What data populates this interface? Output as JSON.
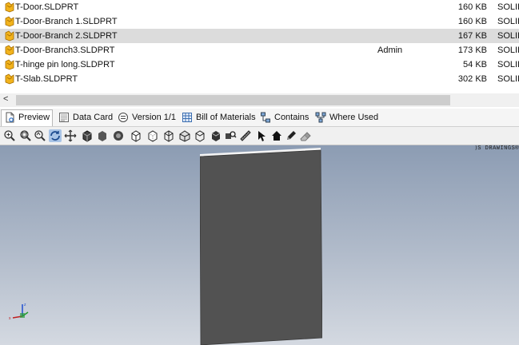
{
  "files": [
    {
      "name": "T-Door.SLDPRT",
      "user": "",
      "size": "160 KB",
      "type": "SOLID",
      "selected": false
    },
    {
      "name": "T-Door-Branch 1.SLDPRT",
      "user": "",
      "size": "160 KB",
      "type": "SOLID",
      "selected": false
    },
    {
      "name": "T-Door-Branch 2.SLDPRT",
      "user": "",
      "size": "167 KB",
      "type": "SOLID",
      "selected": true
    },
    {
      "name": "T-Door-Branch3.SLDPRT",
      "user": "Admin",
      "size": "173 KB",
      "type": "SOLID",
      "selected": false
    },
    {
      "name": "T-hinge pin long.SLDPRT",
      "user": "",
      "size": "54 KB",
      "type": "SOLID",
      "selected": false
    },
    {
      "name": "T-Slab.SLDPRT",
      "user": "",
      "size": "302 KB",
      "type": "SOLID",
      "selected": false
    }
  ],
  "scroll": {
    "left_arrow": "<"
  },
  "tabs": [
    {
      "label": "Preview",
      "icon": "preview-icon",
      "active": true
    },
    {
      "label": "Data Card",
      "icon": "data-card-icon",
      "active": false
    },
    {
      "label": "Version 1/1",
      "icon": "version-icon",
      "active": false
    },
    {
      "label": "Bill of Materials",
      "icon": "bill-of-materials-icon",
      "active": false
    },
    {
      "label": "Contains",
      "icon": "contains-icon",
      "active": false
    },
    {
      "label": "Where Used",
      "icon": "where-used-icon",
      "active": false
    }
  ],
  "toolbar": {
    "icons": [
      "zoom-to-fit-icon",
      "zoom-to-area-icon",
      "zoom-in-out-icon",
      "rotate-icon",
      "pan-icon",
      "shaded-with-edges-icon",
      "shaded-icon",
      "draft-quality-icon",
      "hidden-lines-removed-icon",
      "hidden-lines-visible-icon",
      "wireframe-icon",
      "perspective-icon",
      "isometric-icon",
      "view-cube-icon",
      "section-view-icon",
      "measure-icon",
      "select-icon",
      "home-view-icon",
      "markup-pen-icon",
      "erase-icon"
    ]
  },
  "viewer": {
    "brand": "⟩S DRAWINGS®"
  },
  "colors": {
    "selected_row": "#dcdcdc",
    "viewport_top": "#8c9cb3",
    "viewport_bottom": "#d4d9e1",
    "part": "#525252"
  }
}
